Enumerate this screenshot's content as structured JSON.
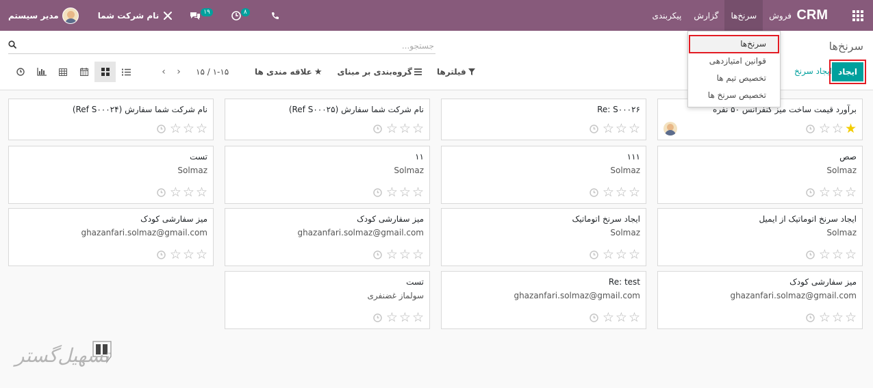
{
  "navbar": {
    "brand": "CRM",
    "menu": [
      {
        "label": "فروش"
      },
      {
        "label": "سرنخ‌ها",
        "active": true
      },
      {
        "label": "گزارش"
      },
      {
        "label": "پیکربندی"
      }
    ],
    "activity_count": "۸",
    "messages_count": "۱۹",
    "company": "نام شرکت شما",
    "user": "مدیر سیستم"
  },
  "dropdown": {
    "items": [
      "سرنخ‌ها",
      "قوانین امتیازدهی",
      "تخصیص تیم ها",
      "تخصیص سرنخ ها"
    ]
  },
  "control_panel": {
    "breadcrumb": "سرنخ‌ها",
    "search_placeholder": "جستجو...",
    "create_label": "ایجاد",
    "generate_label": "ایجاد سرنخ",
    "filters_label": "فیلترها",
    "groupby_label": "گروه‌بندی بر مبنای",
    "favorites_label": "علاقه مندی ها",
    "pager_range": "۱-۱۵ / ۱۵"
  },
  "cards": [
    {
      "title": "برآورد قیمت ساخت میز کنفرانس ۵۰ نفره",
      "subtitle": "",
      "stars": 1,
      "avatar": true
    },
    {
      "title": "Re: S۰۰۰۲۶",
      "subtitle": "",
      "stars": 0,
      "avatar": false
    },
    {
      "title": "نام شرکت شما سفارش (Ref S۰۰۰۲۵)",
      "subtitle": "",
      "stars": 0,
      "avatar": false
    },
    {
      "title": "نام شرکت شما سفارش (Ref S۰۰۰۲۴)",
      "subtitle": "",
      "stars": 0,
      "avatar": false
    },
    {
      "title": "صص",
      "subtitle": "Solmaz",
      "stars": 0,
      "avatar": false
    },
    {
      "title": "۱۱۱",
      "subtitle": "Solmaz",
      "stars": 0,
      "avatar": false
    },
    {
      "title": "۱۱",
      "subtitle": "Solmaz",
      "stars": 0,
      "avatar": false
    },
    {
      "title": "تست",
      "subtitle": "Solmaz",
      "stars": 0,
      "avatar": false
    },
    {
      "title": "ایجاد سرنخ اتوماتیک از ایمیل",
      "subtitle": "Solmaz",
      "stars": 0,
      "avatar": false
    },
    {
      "title": "ایجاد سرنخ اتوماتیک",
      "subtitle": "Solmaz",
      "stars": 0,
      "avatar": false
    },
    {
      "title": "میز سفارشی کودک",
      "subtitle": "ghazanfari.solmaz@gmail.com",
      "stars": 0,
      "avatar": false
    },
    {
      "title": "میز سفارشی کودک",
      "subtitle": "ghazanfari.solmaz@gmail.com",
      "stars": 0,
      "avatar": false
    },
    {
      "title": "میز سفارشی کودک",
      "subtitle": "ghazanfari.solmaz@gmail.com",
      "stars": 0,
      "avatar": false
    },
    {
      "title": "Re: test",
      "subtitle": "ghazanfari.solmaz@gmail.com",
      "stars": 0,
      "avatar": false
    },
    {
      "title": "تست",
      "subtitle": "سولماز غضنفری",
      "stars": 0,
      "avatar": false
    }
  ],
  "watermark": "تسهیل‌گستر",
  "colors": {
    "primary": "#875a7b",
    "accent": "#00a09d",
    "highlight": "#e31b23",
    "star_on": "#f3cc00"
  }
}
